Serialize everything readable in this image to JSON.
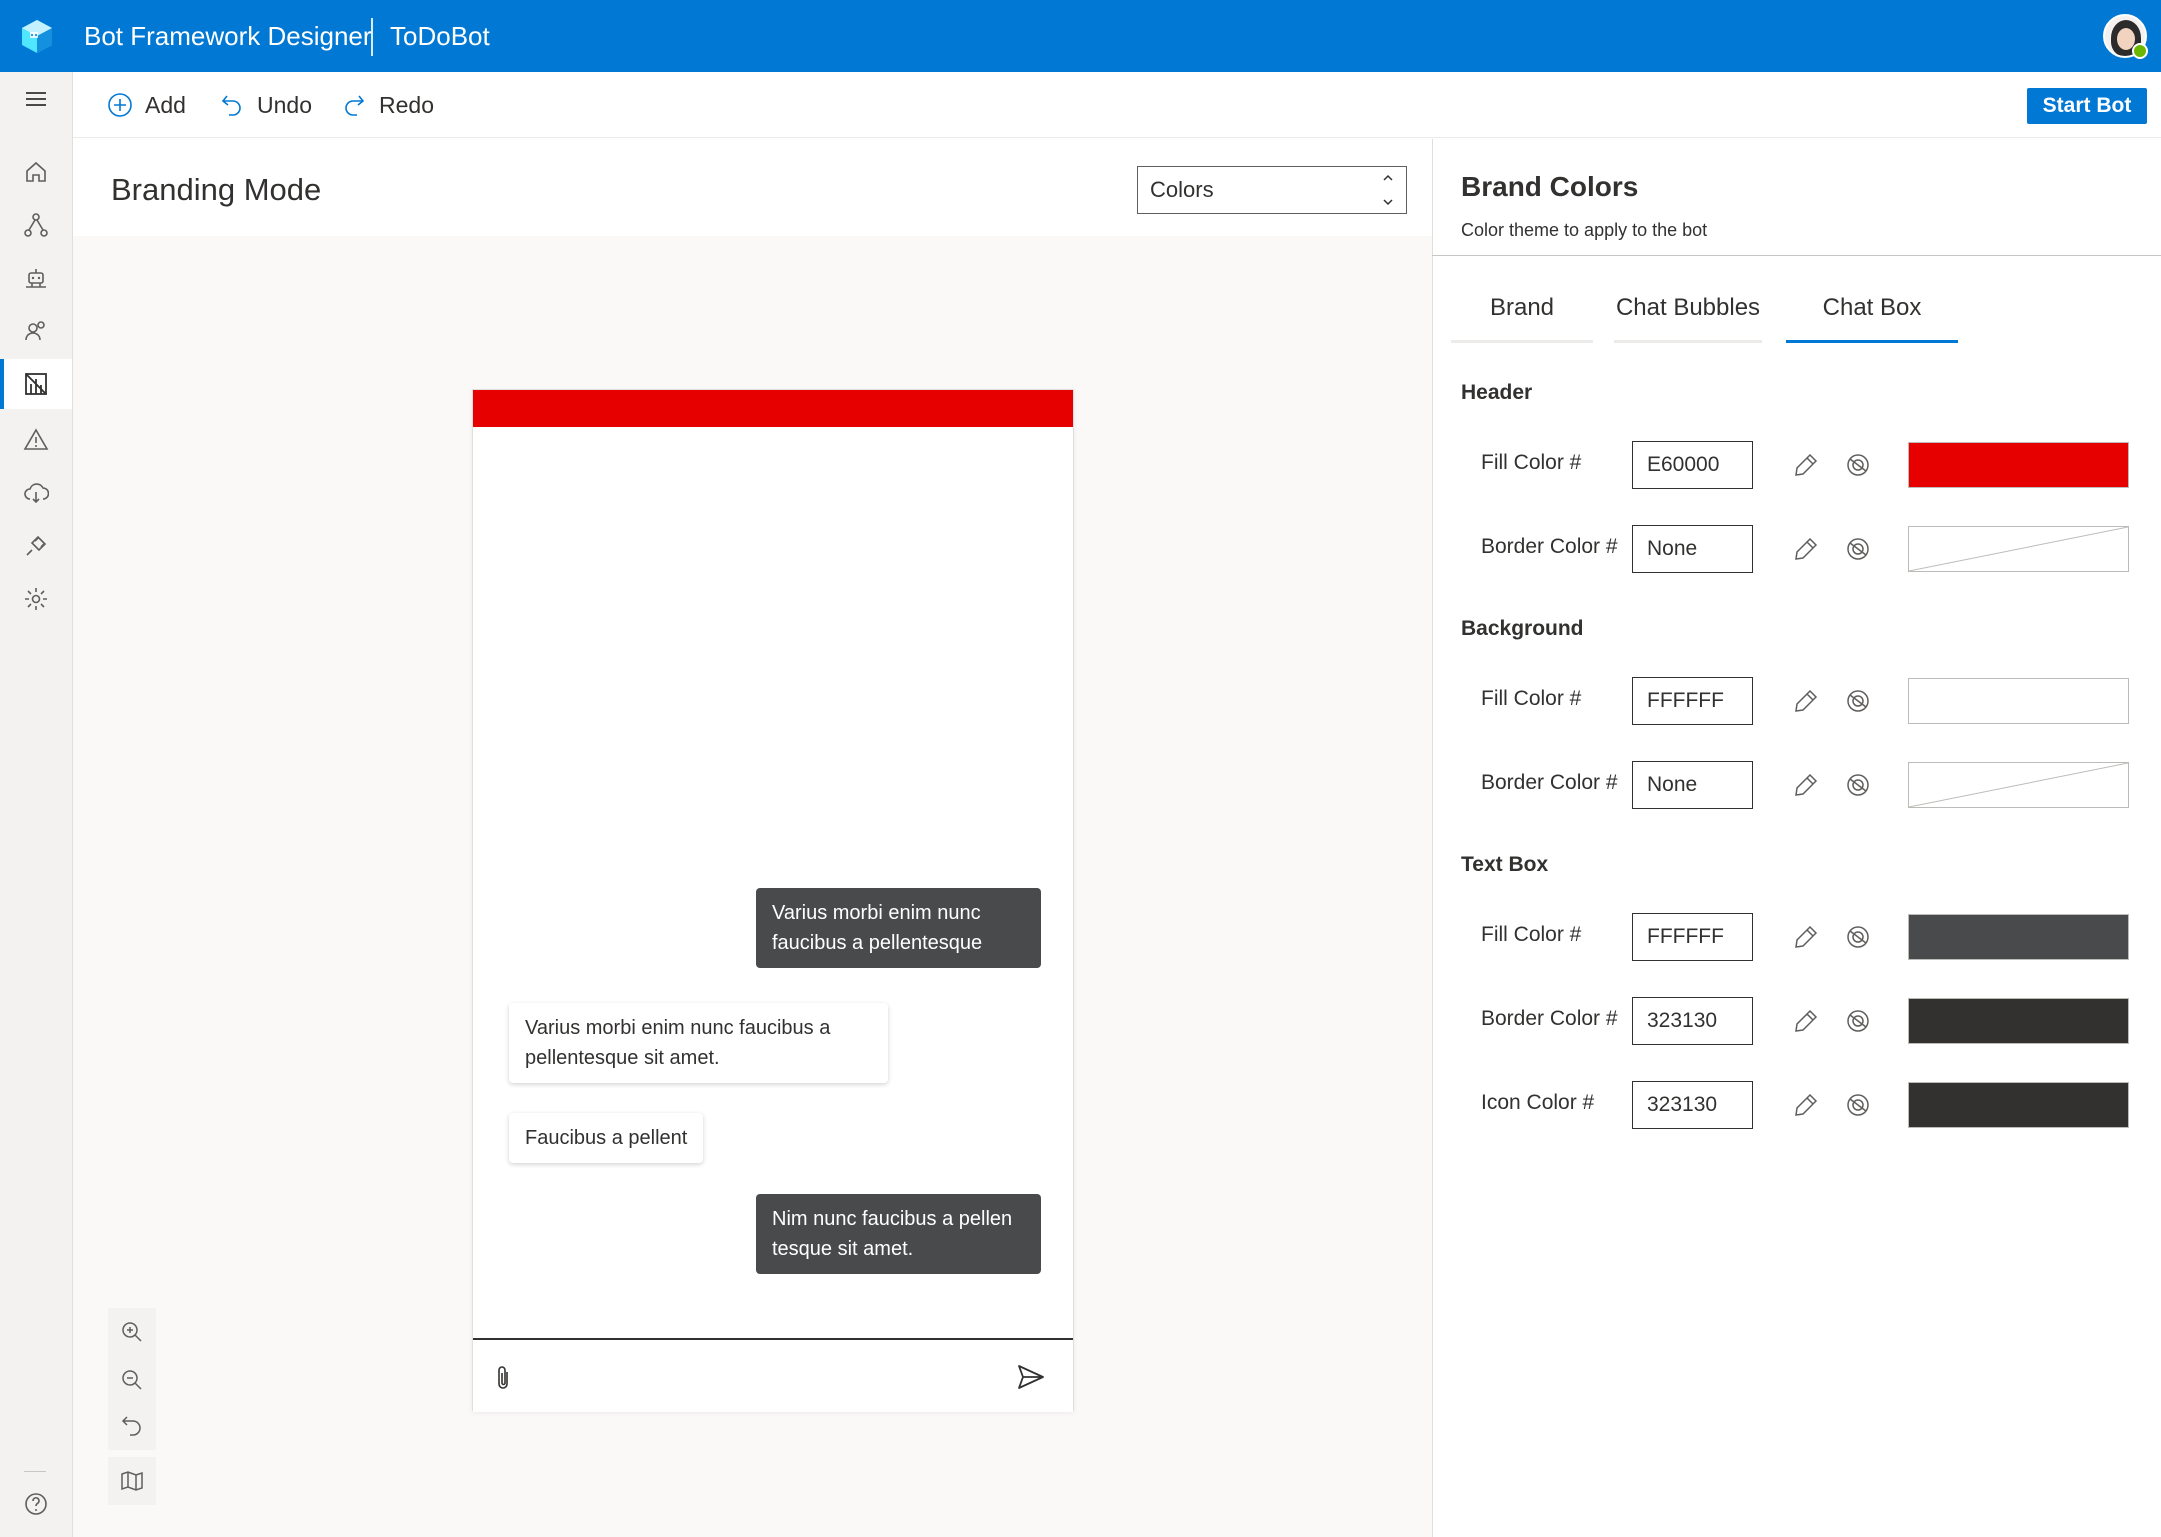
{
  "header": {
    "app_title": "Bot Framework Designer",
    "project_name": "ToDoBot"
  },
  "toolbar": {
    "add_label": "Add",
    "undo_label": "Undo",
    "redo_label": "Redo",
    "start_bot_label": "Start Bot"
  },
  "nav": {
    "items": [
      "home-icon",
      "flow-icon",
      "bot-icon",
      "users-icon",
      "branding-icon",
      "warning-icon",
      "cloud-publish-icon",
      "plug-icon",
      "gear-icon"
    ],
    "active": "branding-icon",
    "help": "help-icon"
  },
  "canvas": {
    "title": "Branding Mode",
    "mode_select": "Colors"
  },
  "chat": {
    "header_color": "#E60000",
    "messages": [
      {
        "from": "user",
        "text": "Varius morbi enim nunc faucibus a pellentesque"
      },
      {
        "from": "bot",
        "text": "Varius morbi enim nunc faucibus a pellentesque sit amet."
      },
      {
        "from": "bot",
        "text": "Faucibus a pellent"
      },
      {
        "from": "user",
        "text": "Nim nunc faucibus a pellen tesque sit amet."
      }
    ]
  },
  "panel": {
    "title": "Brand Colors",
    "subtitle": "Color theme to apply to the bot",
    "tabs": [
      "Brand",
      "Chat Bubbles",
      "Chat Box"
    ],
    "active_tab": "Chat Box",
    "sections": [
      {
        "label": "Header",
        "rows": [
          {
            "label": "Fill Color #",
            "value": "E60000",
            "swatch": "#E60000"
          },
          {
            "label": "Border Color #",
            "value": "None",
            "swatch": "none"
          }
        ]
      },
      {
        "label": "Background",
        "rows": [
          {
            "label": "Fill Color #",
            "value": "FFFFFF",
            "swatch": "#FFFFFF"
          },
          {
            "label": "Border Color #",
            "value": "None",
            "swatch": "none"
          }
        ]
      },
      {
        "label": "Text Box",
        "rows": [
          {
            "label": "Fill Color #",
            "value": "FFFFFF",
            "swatch": "#484A4C"
          },
          {
            "label": "Border Color #",
            "value": "323130",
            "swatch": "#323130"
          },
          {
            "label": "Icon Color #",
            "value": "323130",
            "swatch": "#323130"
          }
        ]
      }
    ]
  },
  "colors": {
    "accent": "#0078d4",
    "user_bubble": "#484a4c"
  }
}
